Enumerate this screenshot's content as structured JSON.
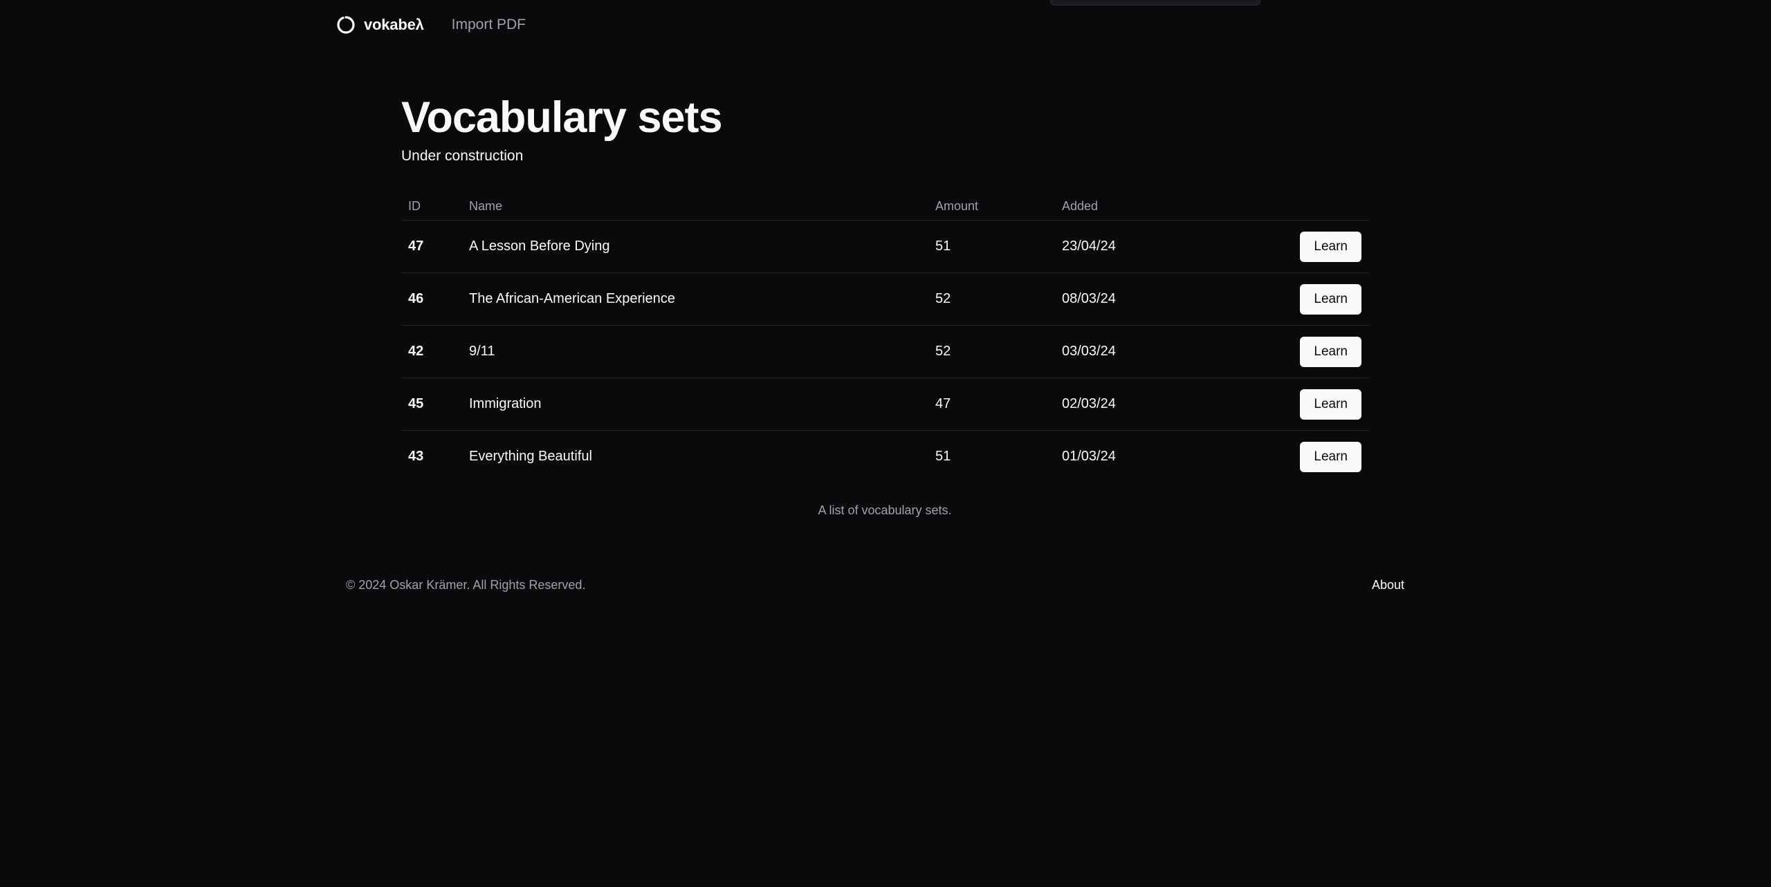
{
  "header": {
    "brand_name": "vokabeλ",
    "nav_import": "Import PDF"
  },
  "main": {
    "title": "Vocabulary sets",
    "subtitle": "Under construction",
    "columns": {
      "id": "ID",
      "name": "Name",
      "amount": "Amount",
      "added": "Added"
    },
    "rows": [
      {
        "id": "47",
        "name": "A Lesson Before Dying",
        "amount": "51",
        "added": "23/04/24",
        "action": "Learn"
      },
      {
        "id": "46",
        "name": "The African-American Experience",
        "amount": "52",
        "added": "08/03/24",
        "action": "Learn"
      },
      {
        "id": "42",
        "name": "9/11",
        "amount": "52",
        "added": "03/03/24",
        "action": "Learn"
      },
      {
        "id": "45",
        "name": "Immigration",
        "amount": "47",
        "added": "02/03/24",
        "action": "Learn"
      },
      {
        "id": "43",
        "name": "Everything Beautiful",
        "amount": "51",
        "added": "01/03/24",
        "action": "Learn"
      }
    ],
    "caption": "A list of vocabulary sets."
  },
  "footer": {
    "copyright": "© 2024 Oskar Krämer. All Rights Reserved.",
    "about": "About"
  },
  "colors": {
    "background": "#0a0a0c",
    "text": "#fafafa",
    "muted": "#a1a1aa",
    "border": "#232327",
    "button_bg": "#fafafa",
    "button_text": "#0a0a0c"
  },
  "icons": {
    "brand": "circle-logo-icon"
  }
}
